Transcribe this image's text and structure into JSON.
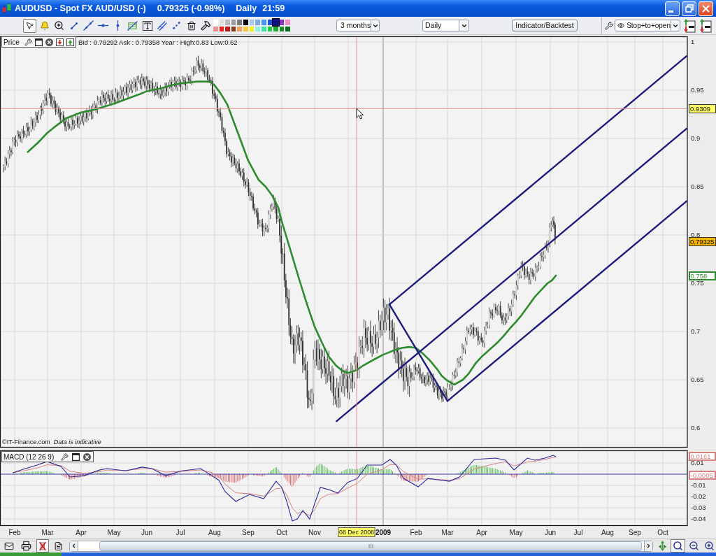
{
  "window": {
    "title": "AUDUSD - Spot FX AUD/USD (-)",
    "quote": "0.79325 (-0.98%)",
    "interval": "Daily",
    "time": "21:59"
  },
  "toolbar": {
    "tools": [
      {
        "kind": "pointer",
        "selected": true
      },
      {
        "kind": "alarm",
        "selected": false
      },
      {
        "kind": "zoom",
        "selected": false
      },
      {
        "kind": "segment",
        "selected": false
      },
      {
        "kind": "line",
        "selected": false
      },
      {
        "kind": "horizontal-line",
        "selected": false
      },
      {
        "kind": "vertical-line",
        "selected": false
      },
      {
        "kind": "fibonacci",
        "selected": false
      },
      {
        "kind": "text",
        "selected": false
      },
      {
        "kind": "parallel",
        "selected": false
      },
      {
        "kind": "points",
        "selected": false
      },
      {
        "kind": "delete",
        "selected": false
      },
      {
        "kind": "tools",
        "selected": false
      }
    ],
    "palette": [
      {
        "color": "#ffffff",
        "selected": false
      },
      {
        "color": "#dcdcdc",
        "selected": false
      },
      {
        "color": "#bdbdbd",
        "selected": false
      },
      {
        "color": "#9e9e9e",
        "selected": false
      },
      {
        "color": "#7a7a7a",
        "selected": false
      },
      {
        "color": "#000000",
        "selected": false
      },
      {
        "color": "#a9c8f0",
        "selected": false
      },
      {
        "color": "#80a8e8",
        "selected": false
      },
      {
        "color": "#4a90f0",
        "selected": false
      },
      {
        "color": "#2050e0",
        "selected": false
      },
      {
        "color": "#12127e",
        "selected": true
      },
      {
        "color": "#8a30c0",
        "selected": false
      },
      {
        "color": "#f08cc8",
        "selected": false
      },
      {
        "color": "#f09090",
        "selected": false
      },
      {
        "color": "#e82020",
        "selected": false
      },
      {
        "color": "#c41818",
        "selected": false
      },
      {
        "color": "#8c4020",
        "selected": false
      },
      {
        "color": "#f0a060",
        "selected": false
      },
      {
        "color": "#f8c840",
        "selected": false
      },
      {
        "color": "#f4f020",
        "selected": false
      },
      {
        "color": "#90f0e4",
        "selected": false
      },
      {
        "color": "#40e4a0",
        "selected": false
      },
      {
        "color": "#20cc40",
        "selected": false
      },
      {
        "color": "#20ac30",
        "selected": false
      },
      {
        "color": "#188c28",
        "selected": false
      },
      {
        "color": "#0a7020",
        "selected": false
      }
    ],
    "period": {
      "value": "3 months"
    },
    "interval": {
      "value": "Daily"
    },
    "indicator_button": "Indicator/Backtest",
    "order_type": {
      "value": "Stop+to+open"
    }
  },
  "price_panel": {
    "title": "Price",
    "info": "Bid : 0.79292 Ask : 0.79358 Year : High:0.83 Low:0.62",
    "y_axis": [
      "1",
      "0.95",
      "0.9",
      "0.85",
      "0.8",
      "0.75",
      "0.7",
      "0.65",
      "0.6"
    ],
    "tags": [
      {
        "kind": "crosshair",
        "label": "0.9309",
        "color": "#ffff66"
      },
      {
        "kind": "filled",
        "label": "0.79325",
        "color": "#f5b400"
      },
      {
        "kind": "outline",
        "label": "0.758",
        "color": "#2e8b2e"
      }
    ],
    "credit": "©IT-Finance.com",
    "disclaimer": "Data is indicative"
  },
  "macd_panel": {
    "title": "MACD (12 26 9)",
    "y_axis": [
      "0.01",
      "-0.01",
      "-0.02",
      "-0.03",
      "-0.04"
    ],
    "tags": [
      {
        "kind": "outline",
        "label": "0.0161",
        "color": "#d88080"
      },
      {
        "kind": "outline",
        "label": "-0.0005",
        "color": "#d88080"
      }
    ]
  },
  "time_axis": {
    "labels": [
      {
        "kind": "month",
        "label": "Feb"
      },
      {
        "kind": "month",
        "label": "Mar"
      },
      {
        "kind": "month",
        "label": "Apr"
      },
      {
        "kind": "month",
        "label": "May"
      },
      {
        "kind": "month",
        "label": "Jun"
      },
      {
        "kind": "month",
        "label": "Jul"
      },
      {
        "kind": "month",
        "label": "Aug"
      },
      {
        "kind": "month",
        "label": "Sep"
      },
      {
        "kind": "month",
        "label": "Oct"
      },
      {
        "kind": "month",
        "label": "Nov"
      },
      {
        "kind": "year",
        "label": "2009"
      },
      {
        "kind": "month",
        "label": "Feb"
      },
      {
        "kind": "month",
        "label": "Mar"
      },
      {
        "kind": "month",
        "label": "Apr"
      },
      {
        "kind": "month",
        "label": "May"
      },
      {
        "kind": "month",
        "label": "Jun"
      },
      {
        "kind": "month",
        "label": "Jul"
      },
      {
        "kind": "month",
        "label": "Aug"
      },
      {
        "kind": "month",
        "label": "Sep"
      },
      {
        "kind": "month",
        "label": "Oct"
      }
    ],
    "cursor_date": {
      "label": "08 Dec 2008",
      "color": "#ffff66"
    }
  },
  "bottom_toolbar": {
    "left_tools": [
      {
        "kind": "mail",
        "selected": false
      },
      {
        "kind": "print",
        "selected": false
      },
      {
        "kind": "delete",
        "selected": true
      },
      {
        "kind": "report",
        "selected": false
      }
    ],
    "right_tools": [
      {
        "kind": "pan",
        "selected": false
      },
      {
        "kind": "auto-zoom",
        "selected": true
      },
      {
        "kind": "zoom-out",
        "selected": false
      },
      {
        "kind": "zoom-in",
        "selected": false
      }
    ]
  }
}
